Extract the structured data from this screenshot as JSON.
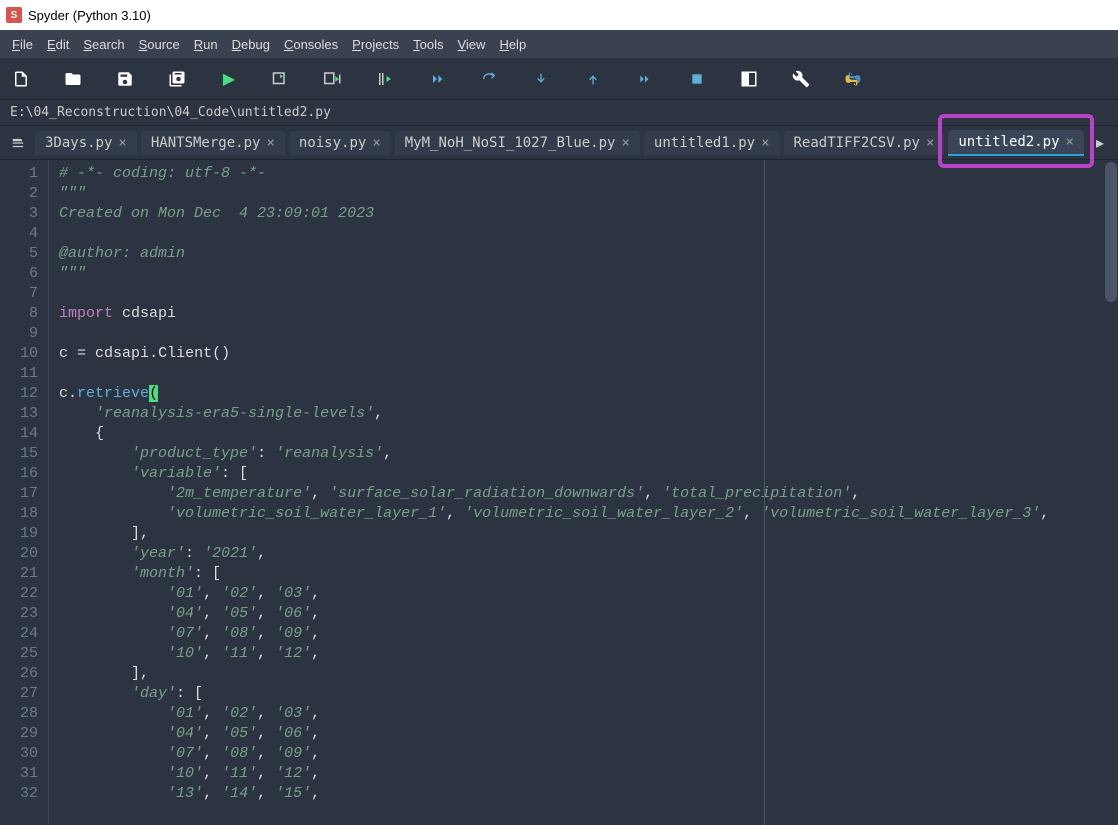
{
  "title": "Spyder (Python 3.10)",
  "menubar": [
    "File",
    "Edit",
    "Search",
    "Source",
    "Run",
    "Debug",
    "Consoles",
    "Projects",
    "Tools",
    "View",
    "Help"
  ],
  "path": "E:\\04_Reconstruction\\04_Code\\untitled2.py",
  "tabs": [
    {
      "label": "3Days.py",
      "active": false
    },
    {
      "label": "HANTSMerge.py",
      "active": false
    },
    {
      "label": "noisy.py",
      "active": false
    },
    {
      "label": "MyM_NoH_NoSI_1027_Blue.py",
      "active": false
    },
    {
      "label": "untitled1.py",
      "active": false
    },
    {
      "label": "ReadTIFF2CSV.py",
      "active": false
    },
    {
      "label": "untitled2.py",
      "active": true
    }
  ],
  "highlight_tab_index": 6,
  "code_lines": [
    [
      [
        "comment",
        "# -*- coding: utf-8 -*-"
      ]
    ],
    [
      [
        "string",
        "\"\"\""
      ]
    ],
    [
      [
        "string",
        "Created on Mon Dec  4 23:09:01 2023"
      ]
    ],
    [],
    [
      [
        "string",
        "@author: admin"
      ]
    ],
    [
      [
        "string",
        "\"\"\""
      ]
    ],
    [],
    [
      [
        "keyword",
        "import"
      ],
      [
        "ident",
        " cdsapi"
      ]
    ],
    [],
    [
      [
        "ident",
        "c "
      ],
      [
        "punct",
        "="
      ],
      [
        "ident",
        " cdsapi"
      ],
      [
        "punct",
        "."
      ],
      [
        "ident",
        "Client"
      ],
      [
        "punct",
        "()"
      ]
    ],
    [],
    [
      [
        "ident",
        "c"
      ],
      [
        "punct",
        "."
      ],
      [
        "func",
        "retrieve"
      ],
      [
        "cursor",
        "("
      ]
    ],
    [
      [
        "ident",
        "    "
      ],
      [
        "string",
        "'reanalysis-era5-single-levels'"
      ],
      [
        "punct",
        ","
      ]
    ],
    [
      [
        "ident",
        "    "
      ],
      [
        "punct",
        "{"
      ]
    ],
    [
      [
        "ident",
        "        "
      ],
      [
        "string",
        "'product_type'"
      ],
      [
        "punct",
        ": "
      ],
      [
        "string",
        "'reanalysis'"
      ],
      [
        "punct",
        ","
      ]
    ],
    [
      [
        "ident",
        "        "
      ],
      [
        "string",
        "'variable'"
      ],
      [
        "punct",
        ": ["
      ]
    ],
    [
      [
        "ident",
        "            "
      ],
      [
        "string",
        "'2m_temperature'"
      ],
      [
        "punct",
        ", "
      ],
      [
        "string",
        "'surface_solar_radiation_downwards'"
      ],
      [
        "punct",
        ", "
      ],
      [
        "string",
        "'total_precipitation'"
      ],
      [
        "punct",
        ","
      ]
    ],
    [
      [
        "ident",
        "            "
      ],
      [
        "string",
        "'volumetric_soil_water_layer_1'"
      ],
      [
        "punct",
        ", "
      ],
      [
        "string",
        "'volumetric_soil_water_layer_2'"
      ],
      [
        "punct",
        ", "
      ],
      [
        "string",
        "'volumetric_soil_water_layer_3'"
      ],
      [
        "punct",
        ","
      ]
    ],
    [
      [
        "ident",
        "        "
      ],
      [
        "punct",
        "],"
      ]
    ],
    [
      [
        "ident",
        "        "
      ],
      [
        "string",
        "'year'"
      ],
      [
        "punct",
        ": "
      ],
      [
        "string",
        "'2021'"
      ],
      [
        "punct",
        ","
      ]
    ],
    [
      [
        "ident",
        "        "
      ],
      [
        "string",
        "'month'"
      ],
      [
        "punct",
        ": ["
      ]
    ],
    [
      [
        "ident",
        "            "
      ],
      [
        "string",
        "'01'"
      ],
      [
        "punct",
        ", "
      ],
      [
        "string",
        "'02'"
      ],
      [
        "punct",
        ", "
      ],
      [
        "string",
        "'03'"
      ],
      [
        "punct",
        ","
      ]
    ],
    [
      [
        "ident",
        "            "
      ],
      [
        "string",
        "'04'"
      ],
      [
        "punct",
        ", "
      ],
      [
        "string",
        "'05'"
      ],
      [
        "punct",
        ", "
      ],
      [
        "string",
        "'06'"
      ],
      [
        "punct",
        ","
      ]
    ],
    [
      [
        "ident",
        "            "
      ],
      [
        "string",
        "'07'"
      ],
      [
        "punct",
        ", "
      ],
      [
        "string",
        "'08'"
      ],
      [
        "punct",
        ", "
      ],
      [
        "string",
        "'09'"
      ],
      [
        "punct",
        ","
      ]
    ],
    [
      [
        "ident",
        "            "
      ],
      [
        "string",
        "'10'"
      ],
      [
        "punct",
        ", "
      ],
      [
        "string",
        "'11'"
      ],
      [
        "punct",
        ", "
      ],
      [
        "string",
        "'12'"
      ],
      [
        "punct",
        ","
      ]
    ],
    [
      [
        "ident",
        "        "
      ],
      [
        "punct",
        "],"
      ]
    ],
    [
      [
        "ident",
        "        "
      ],
      [
        "string",
        "'day'"
      ],
      [
        "punct",
        ": ["
      ]
    ],
    [
      [
        "ident",
        "            "
      ],
      [
        "string",
        "'01'"
      ],
      [
        "punct",
        ", "
      ],
      [
        "string",
        "'02'"
      ],
      [
        "punct",
        ", "
      ],
      [
        "string",
        "'03'"
      ],
      [
        "punct",
        ","
      ]
    ],
    [
      [
        "ident",
        "            "
      ],
      [
        "string",
        "'04'"
      ],
      [
        "punct",
        ", "
      ],
      [
        "string",
        "'05'"
      ],
      [
        "punct",
        ", "
      ],
      [
        "string",
        "'06'"
      ],
      [
        "punct",
        ","
      ]
    ],
    [
      [
        "ident",
        "            "
      ],
      [
        "string",
        "'07'"
      ],
      [
        "punct",
        ", "
      ],
      [
        "string",
        "'08'"
      ],
      [
        "punct",
        ", "
      ],
      [
        "string",
        "'09'"
      ],
      [
        "punct",
        ","
      ]
    ],
    [
      [
        "ident",
        "            "
      ],
      [
        "string",
        "'10'"
      ],
      [
        "punct",
        ", "
      ],
      [
        "string",
        "'11'"
      ],
      [
        "punct",
        ", "
      ],
      [
        "string",
        "'12'"
      ],
      [
        "punct",
        ","
      ]
    ],
    [
      [
        "ident",
        "            "
      ],
      [
        "string",
        "'13'"
      ],
      [
        "punct",
        ", "
      ],
      [
        "string",
        "'14'"
      ],
      [
        "punct",
        ", "
      ],
      [
        "string",
        "'15'"
      ],
      [
        "punct",
        ","
      ]
    ]
  ]
}
